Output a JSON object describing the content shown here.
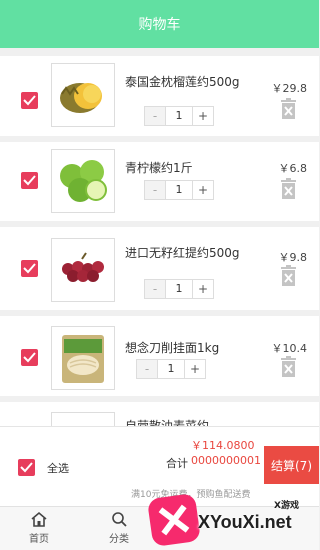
{
  "header": {
    "title": "购物车"
  },
  "cart": {
    "items": [
      {
        "name": "泰国金枕榴莲约500g",
        "quantity": "1",
        "price": "￥29.8",
        "minus": "-",
        "plus": "+",
        "checked": true,
        "image": "durian"
      },
      {
        "name": "青柠檬约1斤",
        "quantity": "1",
        "price": "￥6.8",
        "minus": "-",
        "plus": "+",
        "checked": true,
        "image": "lime"
      },
      {
        "name": "进口无籽红提约500g",
        "quantity": "1",
        "price": "￥9.8",
        "minus": "-",
        "plus": "+",
        "checked": true,
        "image": "grapes"
      },
      {
        "name": "想念刀削挂面1kg",
        "quantity": "1",
        "price": "￥10.4",
        "minus": "-",
        "plus": "+",
        "checked": true,
        "image": "noodles"
      },
      {
        "name": "自营散油麦菜约",
        "price": "￥",
        "checked": true,
        "image": "lettuce"
      }
    ]
  },
  "footer": {
    "select_all": "全选",
    "total_label": "合计",
    "total_value": "￥114.08000000000001",
    "checkout": "结算(7)",
    "delivery_note": "满10元免运费，预购鱼配送费"
  },
  "tabbar": {
    "tabs": [
      {
        "label": "首页",
        "icon": "home-icon"
      },
      {
        "label": "分类",
        "icon": "search-icon"
      }
    ]
  },
  "watermark": {
    "text": "XYouXi.net",
    "small": "X游戏"
  },
  "colors": {
    "header": "#61e0a2",
    "accent": "#e73d5c",
    "checkout": "#ea4b43"
  }
}
